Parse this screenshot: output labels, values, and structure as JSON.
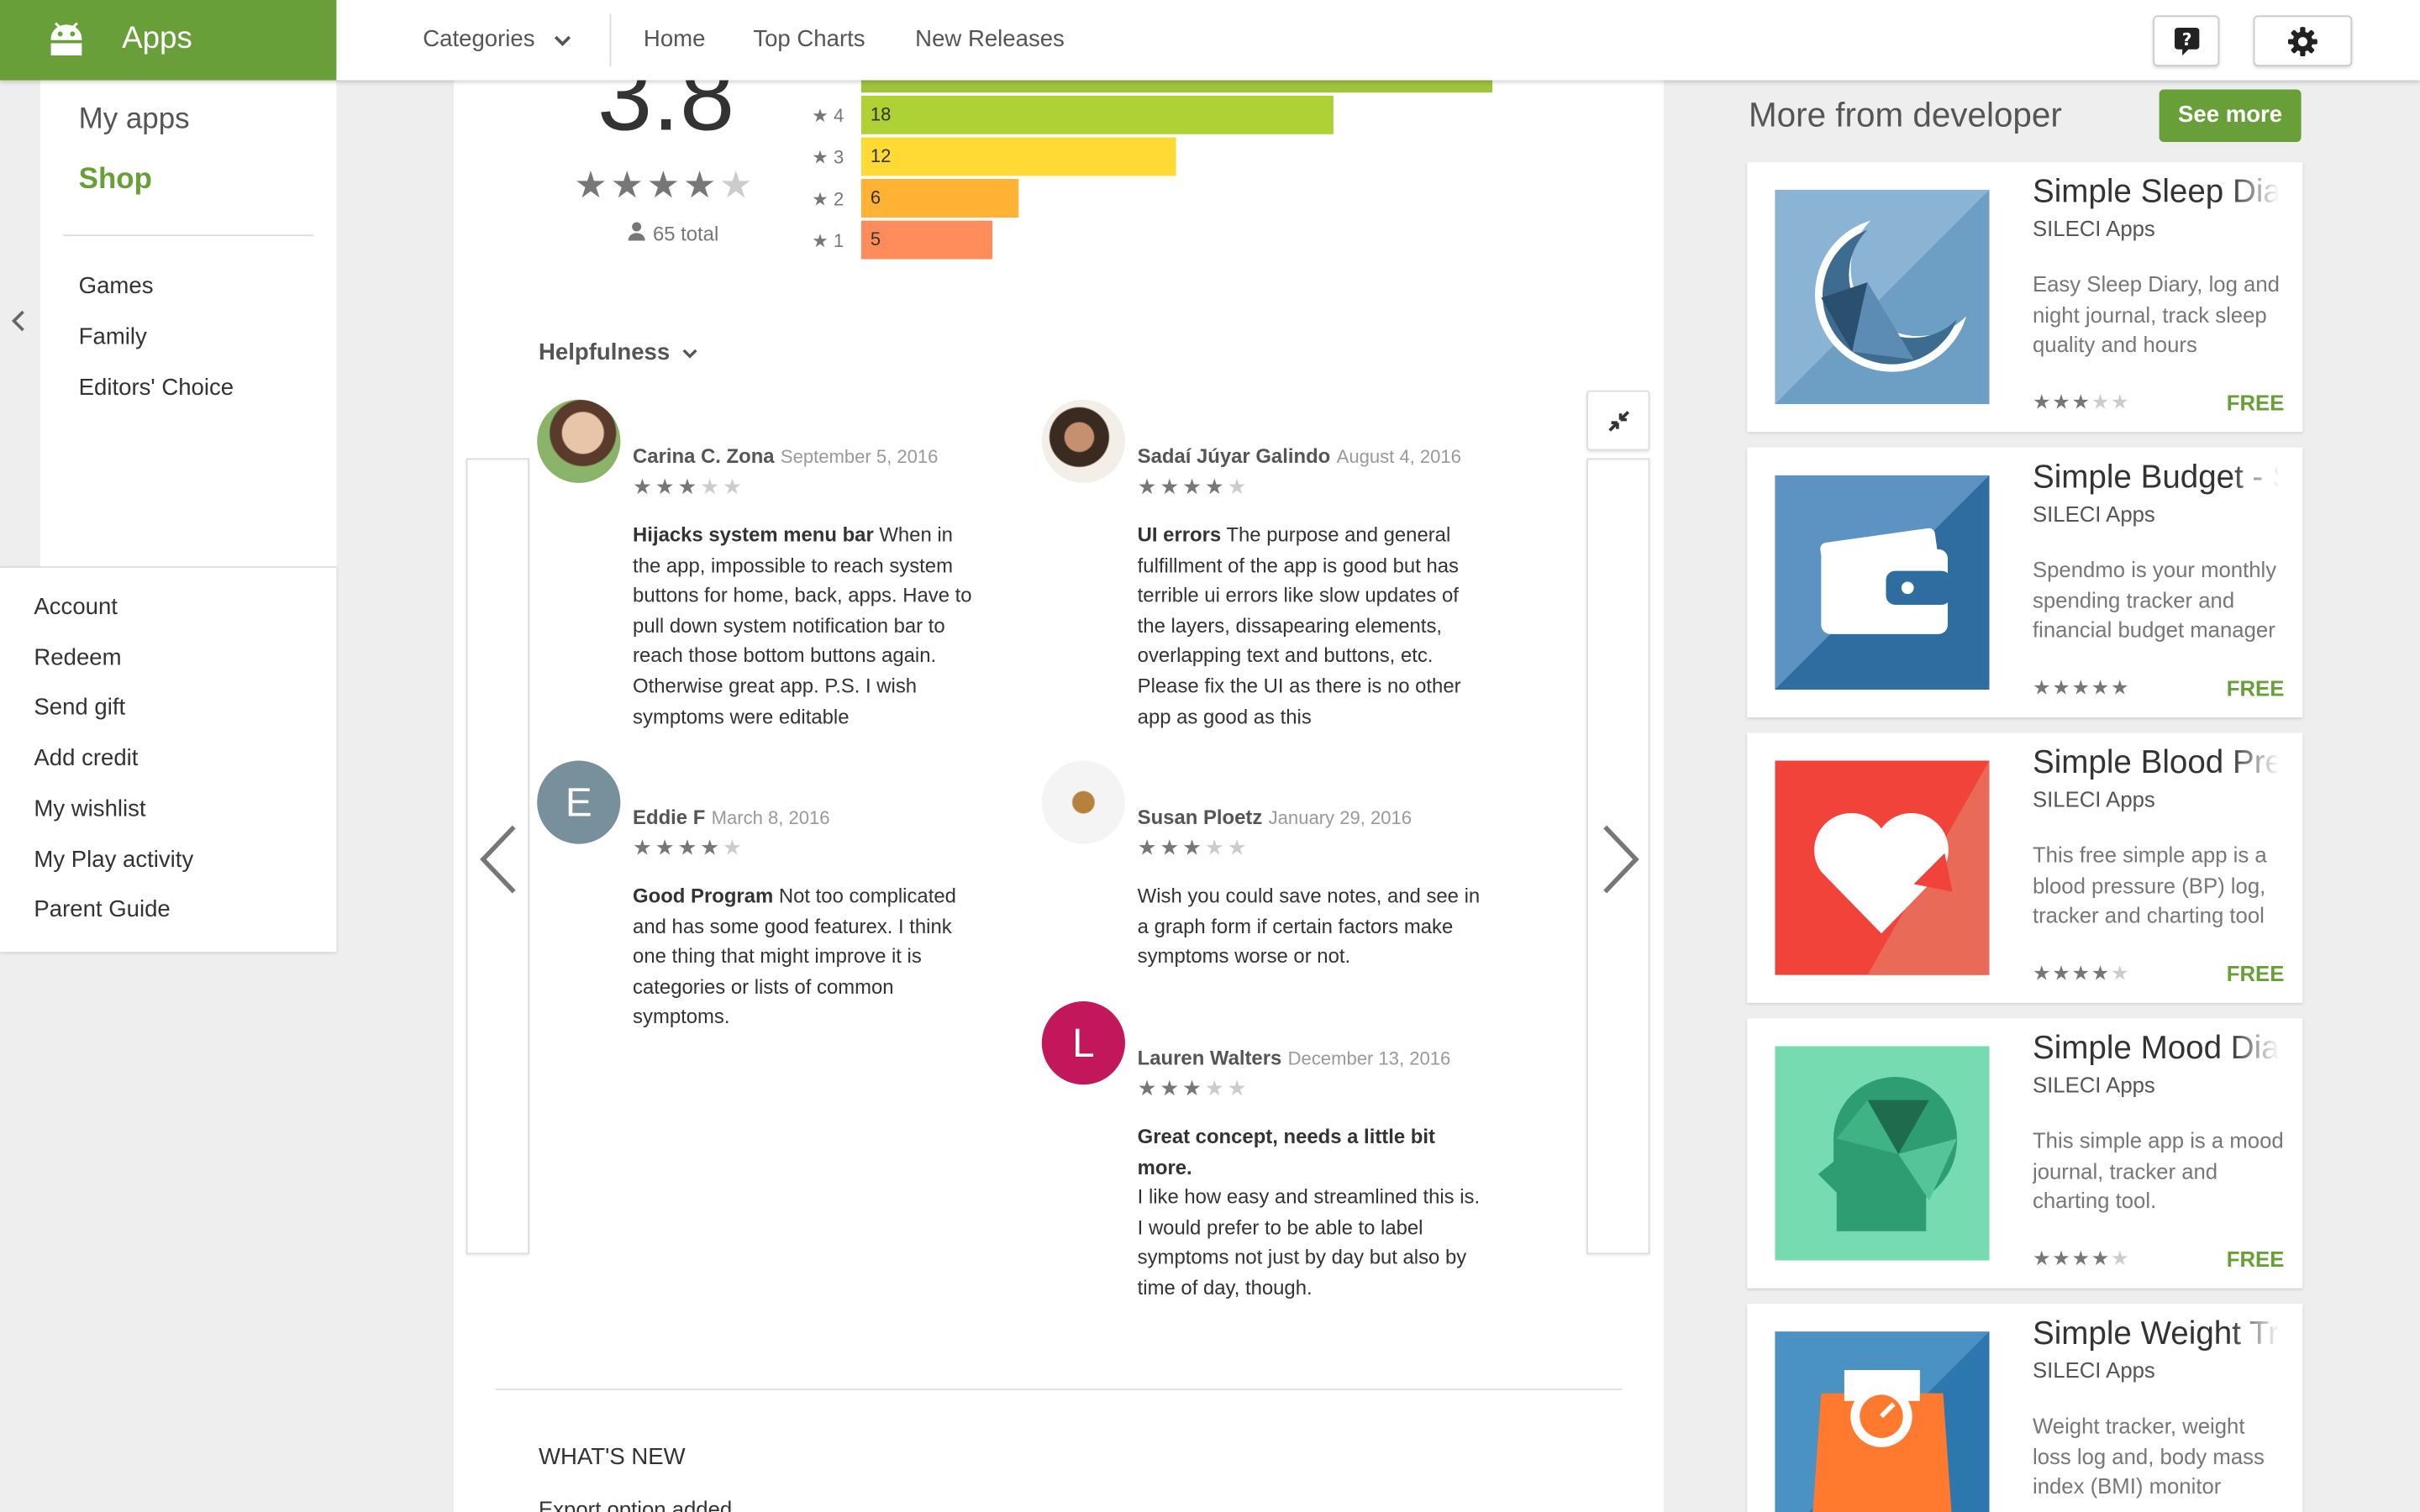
{
  "header": {
    "app_title": "Apps",
    "categories_label": "Categories",
    "nav": [
      "Home",
      "Top Charts",
      "New Releases"
    ]
  },
  "sidebar": {
    "primary": [
      "My apps",
      "Shop"
    ],
    "sections": [
      "Games",
      "Family",
      "Editors' Choice"
    ],
    "account_links": [
      "Account",
      "Redeem",
      "Send gift",
      "Add credit",
      "My wishlist",
      "My Play activity",
      "Parent Guide"
    ]
  },
  "rating": {
    "score": "3.8",
    "total": "65 total",
    "stars": 4,
    "histogram": [
      {
        "label": "4",
        "count": "18",
        "value": 18,
        "color": "#aed135"
      },
      {
        "label": "3",
        "count": "12",
        "value": 12,
        "color": "#ffda35"
      },
      {
        "label": "2",
        "count": "6",
        "value": 6,
        "color": "#ffb233"
      },
      {
        "label": "1",
        "count": "5",
        "value": 5,
        "color": "#ff8c5a"
      }
    ]
  },
  "sort_label": "Helpfulness",
  "reviews": [
    {
      "name": "Carina C. Zona",
      "date": "September 5, 2016",
      "stars": 3,
      "title": "Hijacks system menu bar",
      "body": " When in the app, impossible to reach system buttons for home, back, apps. Have to pull down system notification bar to reach those bottom buttons again. Otherwise great app. P.S. I wish symptoms were editable"
    },
    {
      "name": "Sadaí Júyar Galindo",
      "date": "August 4, 2016",
      "stars": 4,
      "title": "UI errors",
      "body": " The purpose and general fulfillment of the app is good but has terrible ui errors like slow updates of the layers, dissapearing elements, overlapping text and buttons, etc. Please fix the UI as there is no other app as good as this"
    },
    {
      "name": "Eddie F",
      "date": "March 8, 2016",
      "stars": 4,
      "initial": "E",
      "title": "Good Program",
      "body": " Not too complicated and has some good featurex. I think one thing that might improve it is categories or lists of common symptoms."
    },
    {
      "name": "Susan Ploetz",
      "date": "January 29, 2016",
      "stars": 3,
      "title": "",
      "body": "Wish you could save notes, and see in a graph form if certain factors make symptoms worse or not."
    },
    {
      "name": "Lauren Walters",
      "date": "December 13, 2016",
      "stars": 3,
      "initial": "L",
      "title": "Great concept, needs a little bit more.",
      "body": "I like how easy and streamlined this is. I would prefer to be able to label symptoms not just by day but also by time of day, though."
    }
  ],
  "whats_new": {
    "heading": "WHAT'S NEW",
    "first_line": "Export option added"
  },
  "more_from_developer": {
    "heading": "More from developer",
    "see_more": "See more",
    "apps": [
      {
        "title": "Simple Sleep Diary",
        "dev": "SILECI Apps",
        "desc": "Easy Sleep Diary, log and night journal, track sleep quality and hours",
        "stars": 3,
        "price": "FREE",
        "icon": "moon-icon"
      },
      {
        "title": "Simple Budget - Spendmo",
        "dev": "SILECI Apps",
        "desc": "Spendmo is your monthly spending tracker and financial budget manager",
        "stars": 5,
        "price": "FREE",
        "icon": "wallet-icon"
      },
      {
        "title": "Simple Blood Pressure",
        "dev": "SILECI Apps",
        "desc": "This free simple app is a blood pressure (BP) log, tracker and charting tool",
        "stars": 4,
        "price": "FREE",
        "icon": "heart-icon"
      },
      {
        "title": "Simple Mood Diary",
        "dev": "SILECI Apps",
        "desc": "This simple app is a mood journal, tracker and charting tool.",
        "stars": 4,
        "price": "FREE",
        "icon": "head-icon"
      },
      {
        "title": "Simple Weight Tracker",
        "dev": "SILECI Apps",
        "desc": "Weight tracker, weight loss log and, body mass index (BMI) monitor",
        "stars": 0,
        "price": "",
        "icon": "scale-icon"
      }
    ]
  },
  "colors": {
    "brand": "#689f38",
    "accent_green": "#689f38",
    "avatar_e": "#78909c",
    "avatar_l": "#c2185b"
  }
}
